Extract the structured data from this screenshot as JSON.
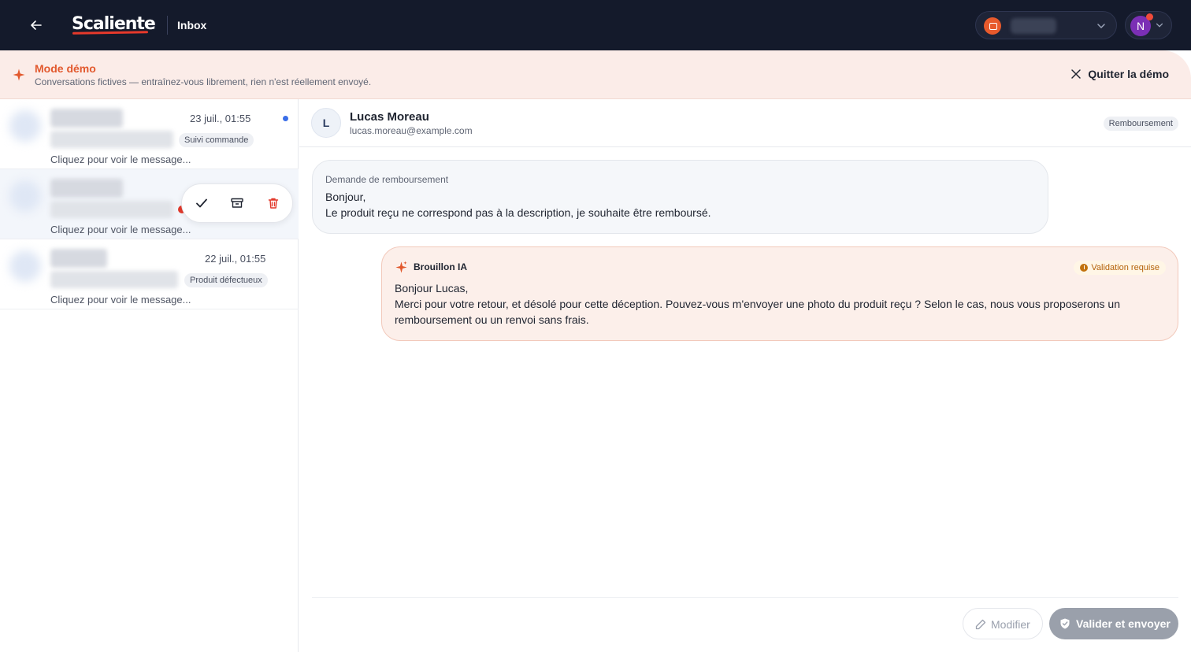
{
  "app": {
    "name": "Scaliente",
    "section": "Inbox"
  },
  "demo": {
    "title": "Mode démo",
    "subtitle": "Conversations fictives — entraînez-vous librement, rien n'est réellement envoyé.",
    "quit_label": "Quitter la démo"
  },
  "user": {
    "initial": "N"
  },
  "conversations": [
    {
      "date": "23 juil., 01:55",
      "tag": "Suivi commande",
      "preview": "Cliquez pour voir le message...",
      "unread": true
    },
    {
      "date": "",
      "tag": "",
      "preview": "Cliquez pour voir le message...",
      "selected": true
    },
    {
      "date": "22 juil., 01:55",
      "tag": "Produit défectueux",
      "preview": "Cliquez pour voir le message..."
    }
  ],
  "contact": {
    "initial": "L",
    "name": "Lucas Moreau",
    "email": "lucas.moreau@example.com",
    "tag": "Remboursement"
  },
  "incoming": {
    "subject": "Demande de remboursement",
    "lines": [
      "Bonjour,",
      "Le produit reçu ne correspond pas à la description, je souhaite être remboursé."
    ]
  },
  "draft": {
    "label": "Brouillon IA",
    "status": "Validation requise",
    "lines": [
      "Bonjour Lucas,",
      "Merci pour votre retour, et désolé pour cette déception. Pouvez-vous m'envoyer une photo du produit reçu ? Selon le cas, nous vous proposerons un",
      "remboursement ou un renvoi sans frais."
    ]
  },
  "actions": {
    "modify_label": "Modifier",
    "send_label": "Valider et envoyer"
  },
  "colors": {
    "topbar": "#141a2b",
    "accent": "#e2592e",
    "brand_red": "#e6392b",
    "unread": "#3a6ee8"
  }
}
